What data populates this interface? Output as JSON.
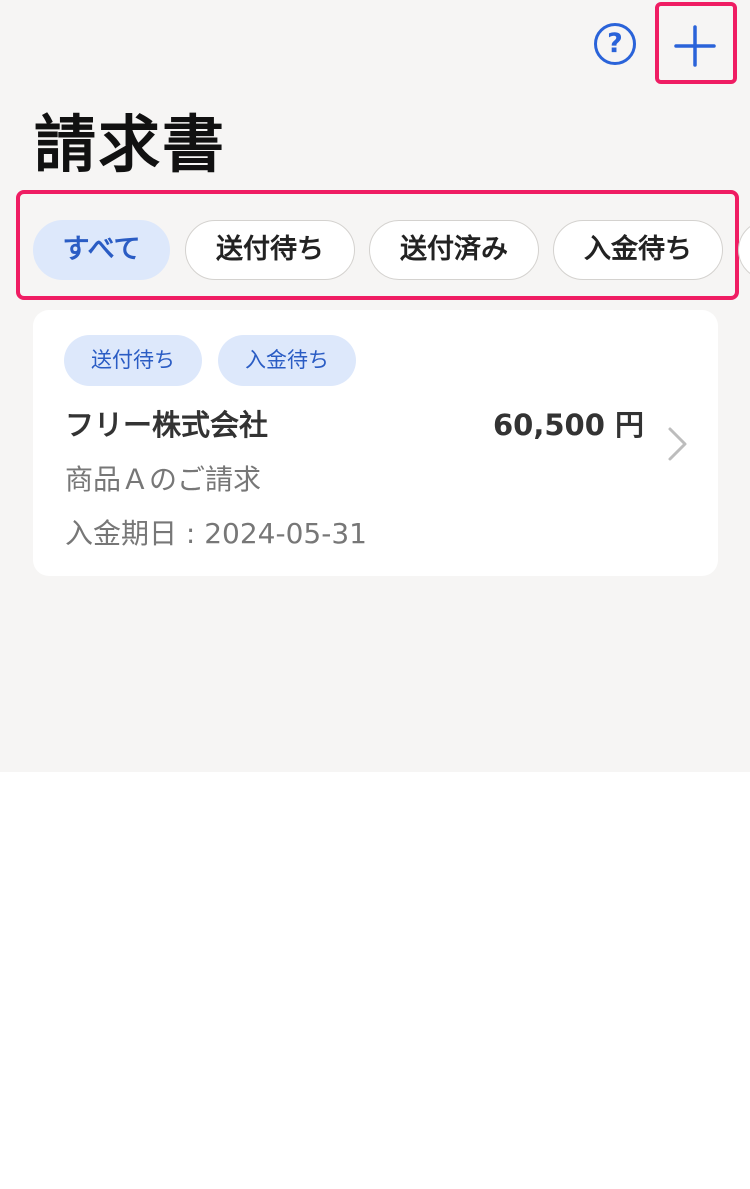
{
  "header": {
    "title": "請求書",
    "help_label": "?",
    "add_icon": "plus-icon",
    "help_icon": "question-circle-icon"
  },
  "filters": [
    {
      "label": "すべて",
      "active": true
    },
    {
      "label": "送付待ち",
      "active": false
    },
    {
      "label": "送付済み",
      "active": false
    },
    {
      "label": "入金待ち",
      "active": false
    }
  ],
  "invoices": [
    {
      "tags": [
        "送付待ち",
        "入金待ち"
      ],
      "company": "フリー株式会社",
      "amount": "60,500 円",
      "subject": "商品Ａのご請求",
      "due": "入金期日 : 2024-05-31"
    }
  ],
  "colors": {
    "accent": "#2a63d9",
    "highlight": "#ef1d63",
    "chip_active_bg": "#dde8fb",
    "background": "#f6f5f4"
  }
}
